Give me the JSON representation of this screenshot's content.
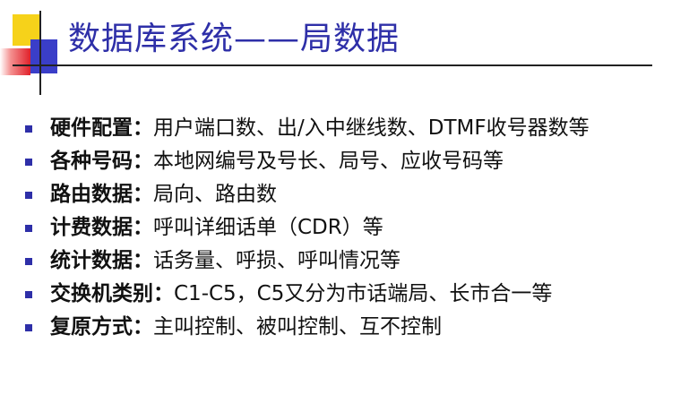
{
  "slide": {
    "title": "数据库系统——局数据",
    "bullets": [
      {
        "term": "硬件配置：",
        "text": "用户端口数、出/入中继线数、DTMF收号器数等"
      },
      {
        "term": "各种号码：",
        "text": "本地网编号及号长、局号、应收号码等"
      },
      {
        "term": "路由数据：",
        "text": "局向、路由数"
      },
      {
        "term": "计费数据：",
        "text": "呼叫详细话单（CDR）等"
      },
      {
        "term": "统计数据：",
        "text": "话务量、呼损、呼叫情况等"
      },
      {
        "term": "交换机类别：",
        "text": "C1-C5，C5又分为市话端局、长市合一等"
      },
      {
        "term": "复原方式：",
        "text": "主叫控制、被叫控制、互不控制"
      }
    ]
  },
  "colors": {
    "title": "#2e2fa8",
    "bullet": "#2e2fa8",
    "accent_yellow": "#f6d21a",
    "accent_red": "#e0202a"
  }
}
